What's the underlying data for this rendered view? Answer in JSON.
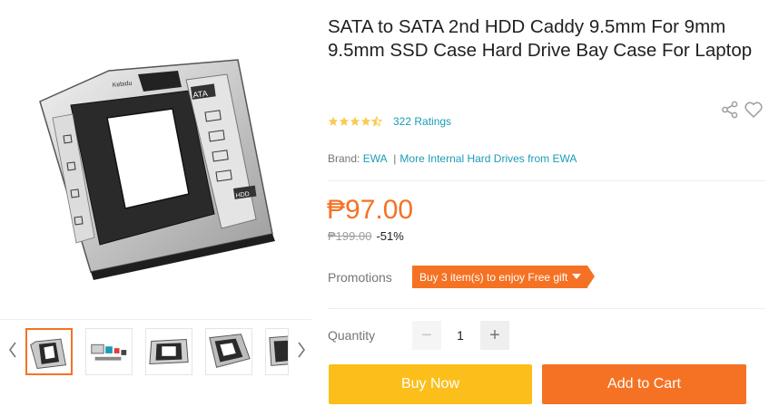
{
  "product": {
    "title": "SATA to SATA 2nd HDD Caddy 9.5mm For 9mm 9.5mm SSD Case Hard Drive Bay Case For Laptop",
    "image_texts": {
      "brand": "Kebidu",
      "ata": "ATA",
      "hdd": "HDD"
    },
    "rating": {
      "stars": 4.5,
      "count_label": "322 Ratings"
    },
    "brand": {
      "label": "Brand:",
      "name": "EWA",
      "separator": "|",
      "more_link": "More Internal Hard Drives from EWA"
    },
    "price": {
      "current": "₱97.00",
      "original": "₱199.00",
      "discount": "-51%"
    },
    "promotions": {
      "label": "Promotions",
      "tag": "Buy 3 item(s) to enjoy Free gift"
    },
    "quantity": {
      "label": "Quantity",
      "value": "1",
      "minus": "−",
      "plus": "+"
    },
    "actions": {
      "buy_now": "Buy Now",
      "add_to_cart": "Add to Cart"
    }
  },
  "gallery": {
    "thumbnail_count": 5,
    "active_index": 0
  },
  "colors": {
    "accent": "#f57224",
    "buy_now": "#fbbe1b",
    "link": "#1a9cb7",
    "star": "#faca51"
  }
}
